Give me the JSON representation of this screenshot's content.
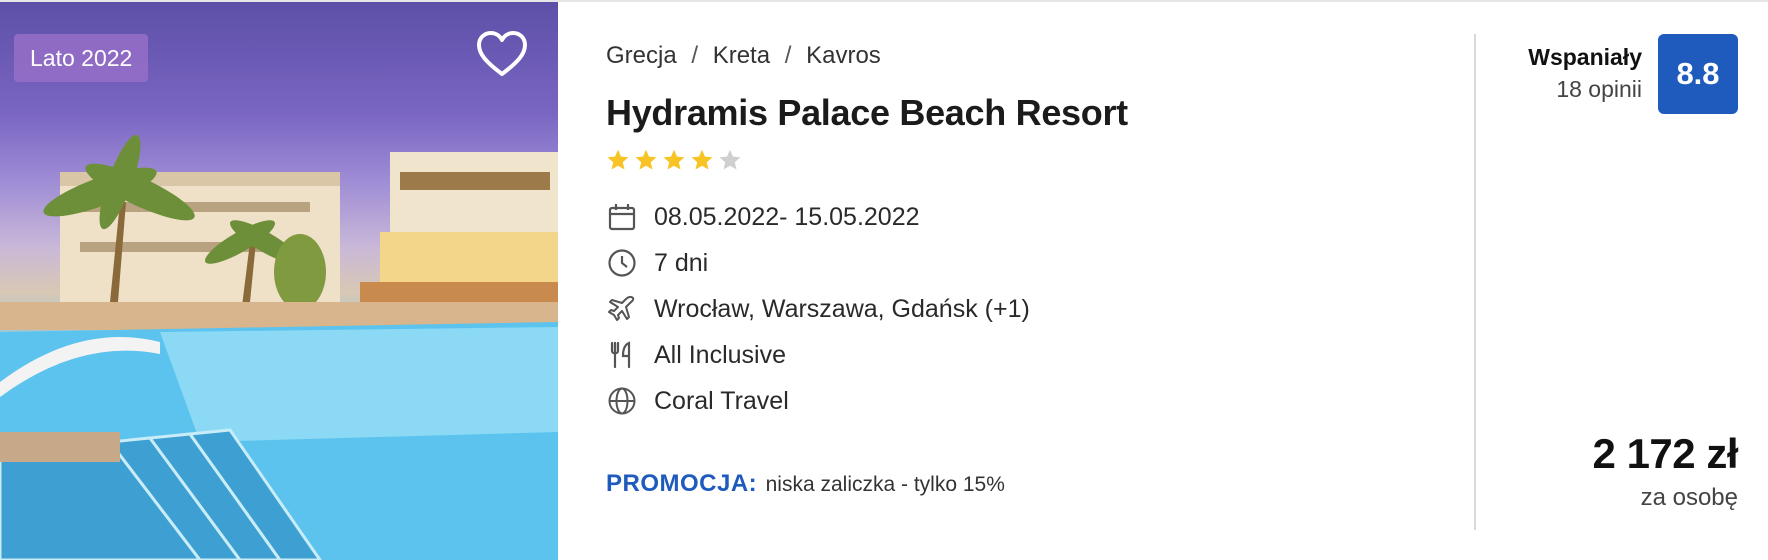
{
  "offer": {
    "season_badge": "Lato 2022",
    "breadcrumb": [
      "Grecja",
      "Kreta",
      "Kavros"
    ],
    "hotel_name": "Hydramis Palace Beach Resort",
    "star_rating": 4,
    "star_max": 5,
    "dates": "08.05.2022- 15.05.2022",
    "duration": "7 dni",
    "departure": "Wrocław, Warszawa, Gdańsk  (+1)",
    "board": "All Inclusive",
    "operator": "Coral Travel",
    "promo": {
      "label": "PROMOCJA:",
      "text": "niska zaliczka - tylko 15%"
    },
    "rating": {
      "word": "Wspaniały",
      "count": "18 opinii",
      "score": "8.8"
    },
    "price": "2 172 zł",
    "price_note": "za osobę"
  },
  "colors": {
    "accent": "#1f5bbd",
    "star_filled": "#f7c325",
    "star_empty": "#cfcfcf",
    "badge_bg": "#9a72c8"
  },
  "icons": {
    "favorite": "heart-icon",
    "dates": "calendar-icon",
    "duration": "clock-icon",
    "departure": "plane-icon",
    "board": "cutlery-icon",
    "operator": "globe-icon"
  }
}
